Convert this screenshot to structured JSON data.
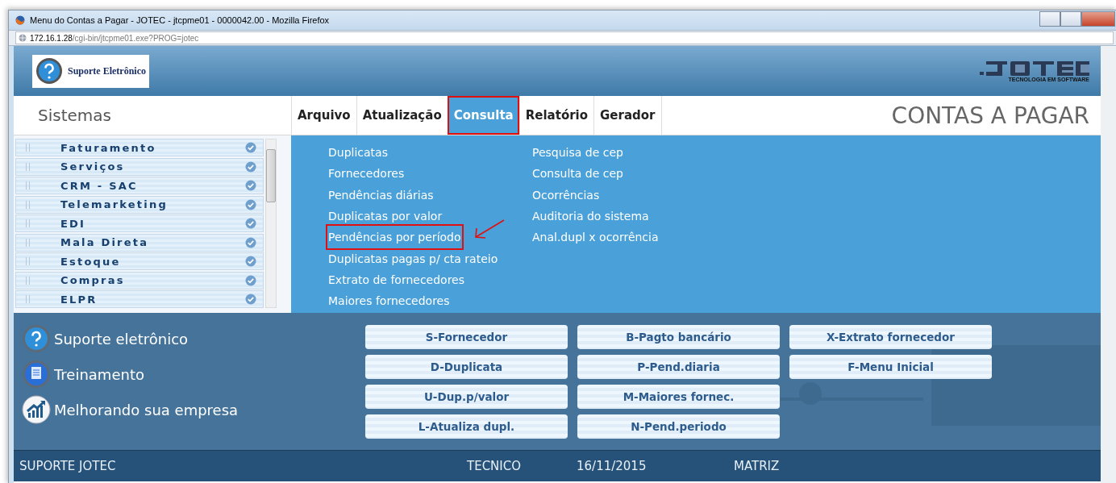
{
  "browser": {
    "title": "Menu do Contas a Pagar - JOTEC - jtcpme01 - 0000042.00 - Mozilla Firefox",
    "url_host": "172.16.1.28",
    "url_path": "/cgi-bin/jtcpme01.exe?PROG=jotec"
  },
  "header": {
    "support_logo_text": "Suporte Eletrônico",
    "brand_subtitle": "TECNOLOGIA EM SOFTWARE"
  },
  "sidebar_title": "Sistemas",
  "menu": [
    {
      "label": "Arquivo",
      "selected": false,
      "annotated": false
    },
    {
      "label": "Atualização",
      "selected": false,
      "annotated": false
    },
    {
      "label": "Consulta",
      "selected": true,
      "annotated": true
    },
    {
      "label": "Relatório",
      "selected": false,
      "annotated": false
    },
    {
      "label": "Gerador",
      "selected": false,
      "annotated": false
    }
  ],
  "module_title": "CONTAS A PAGAR",
  "sidebar": {
    "items": [
      {
        "label": "Faturamento"
      },
      {
        "label": "Serviços"
      },
      {
        "label": "CRM - SAC"
      },
      {
        "label": "Telemarketing"
      },
      {
        "label": "EDI"
      },
      {
        "label": "Mala Direta"
      },
      {
        "label": "Estoque"
      },
      {
        "label": "Compras"
      },
      {
        "label": "ELPR"
      }
    ]
  },
  "dropdown": {
    "columns": [
      [
        {
          "label": "Duplicatas",
          "annotated": false
        },
        {
          "label": "Fornecedores",
          "annotated": false
        },
        {
          "label": "Pendências diárias",
          "annotated": false
        },
        {
          "label": "Duplicatas por valor",
          "annotated": false
        },
        {
          "label": "Pendências por período",
          "annotated": true
        },
        {
          "label": "Duplicatas pagas p/ cta rateio",
          "annotated": false
        },
        {
          "label": "Extrato de fornecedores",
          "annotated": false
        },
        {
          "label": "Maiores fornecedores",
          "annotated": false
        }
      ],
      [
        {
          "label": "Pesquisa de cep",
          "annotated": false
        },
        {
          "label": "Consulta de cep",
          "annotated": false
        },
        {
          "label": "Ocorrências",
          "annotated": false
        },
        {
          "label": "Auditoria do sistema",
          "annotated": false
        },
        {
          "label": "Anal.dupl x ocorrência",
          "annotated": false
        }
      ]
    ]
  },
  "links": [
    {
      "kind": "support",
      "label": "Suporte eletrônico"
    },
    {
      "kind": "training",
      "label": "Treinamento"
    },
    {
      "kind": "growth",
      "label": "Melhorando sua empresa"
    }
  ],
  "shortcut_columns": [
    [
      "S-Fornecedor",
      "D-Duplicata",
      "U-Dup.p/valor",
      "L-Atualiza dupl."
    ],
    [
      "B-Pagto bancário",
      "P-Pend.diaria",
      "M-Maiores fornec.",
      "N-Pend.periodo"
    ],
    [
      "X-Extrato fornecedor",
      "F-Menu Inicial"
    ]
  ],
  "status_bar": [
    "SUPORTE JOTEC",
    "TECNICO",
    "16/11/2015",
    "MATRIZ"
  ]
}
